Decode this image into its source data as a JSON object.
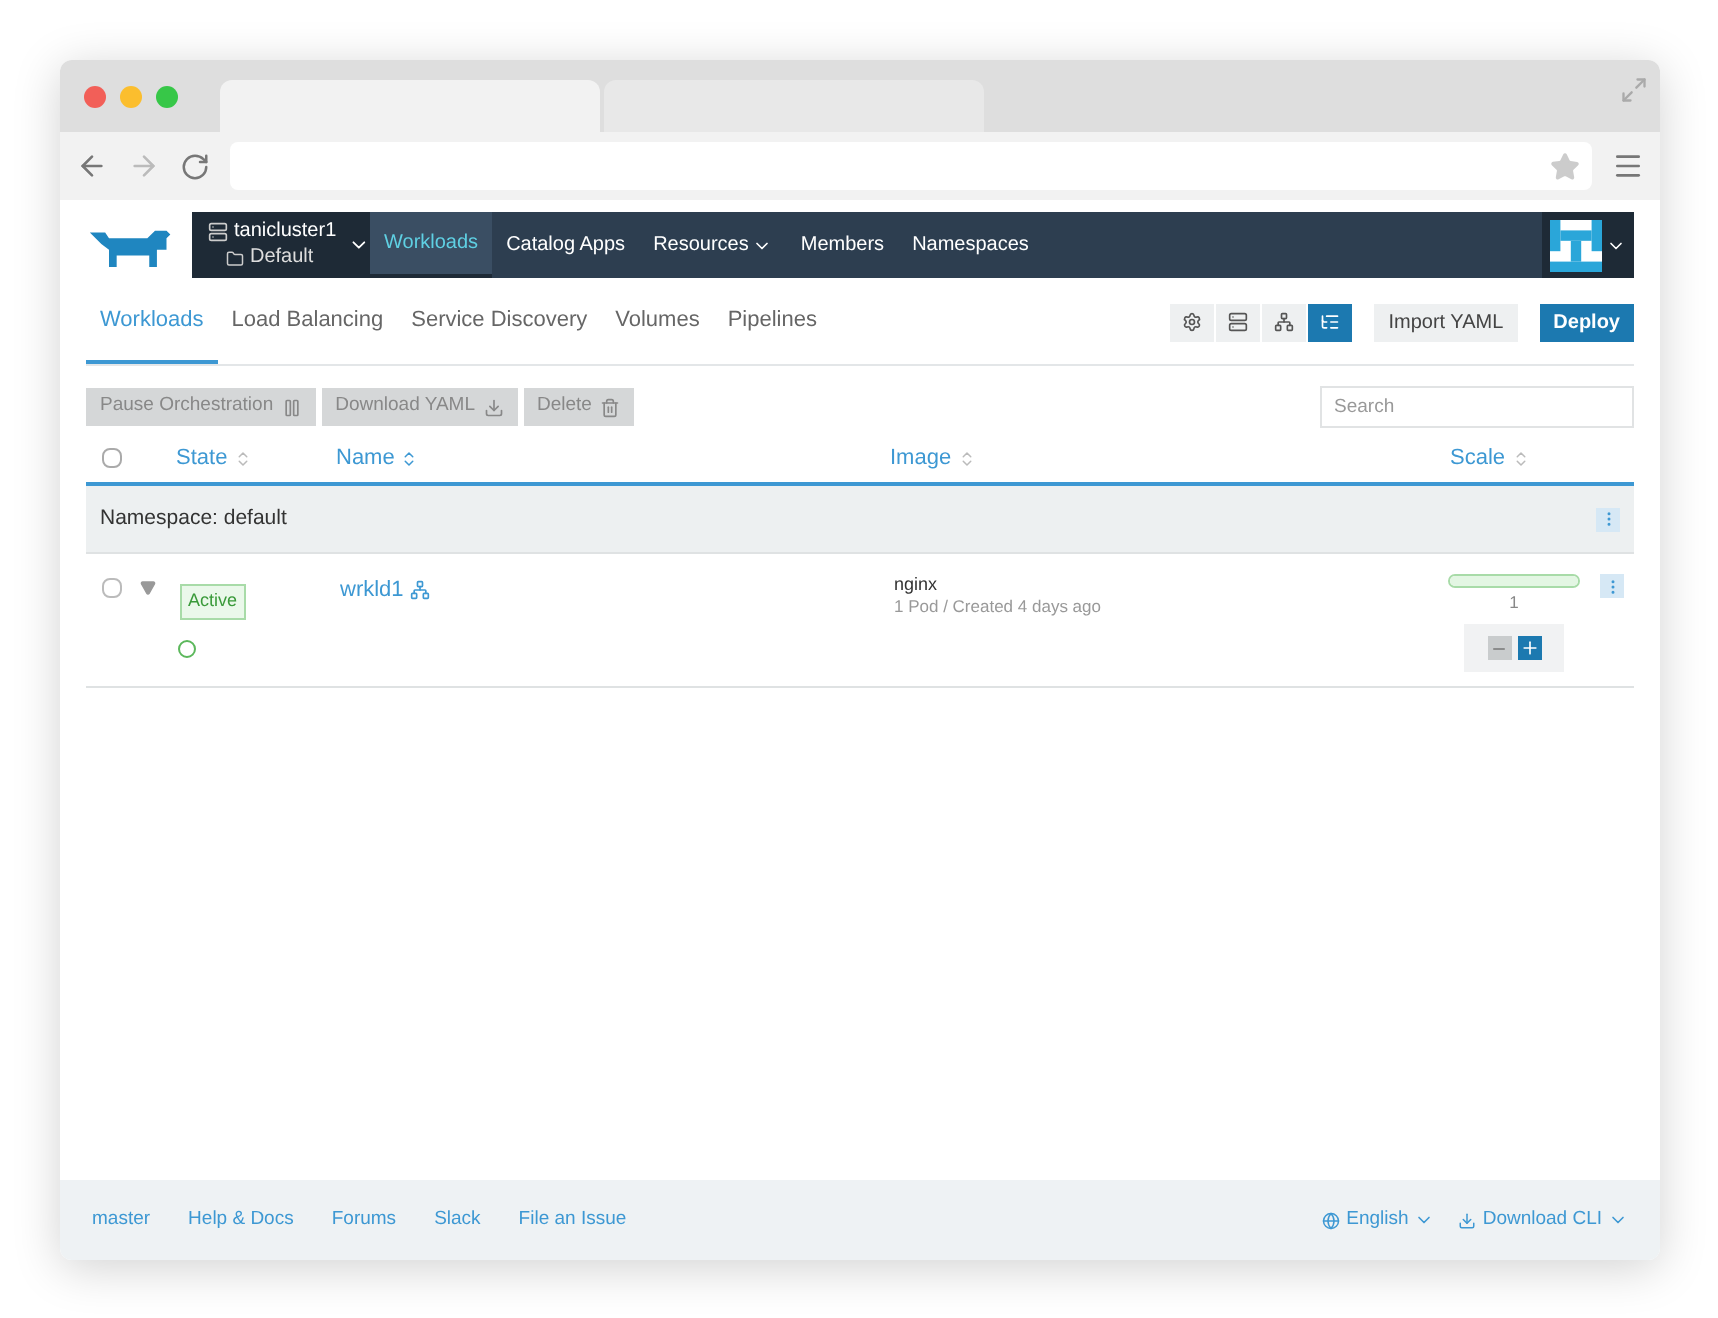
{
  "header": {
    "cluster": "tanicluster1",
    "project": "Default",
    "nav": [
      {
        "label": "Workloads",
        "selected": true,
        "caret": false
      },
      {
        "label": "Catalog Apps",
        "selected": false,
        "caret": false
      },
      {
        "label": "Resources",
        "selected": false,
        "caret": true
      },
      {
        "label": "Members",
        "selected": false,
        "caret": false
      },
      {
        "label": "Namespaces",
        "selected": false,
        "caret": false
      }
    ]
  },
  "tabs": [
    {
      "label": "Workloads",
      "selected": true
    },
    {
      "label": "Load Balancing",
      "selected": false
    },
    {
      "label": "Service Discovery",
      "selected": false
    },
    {
      "label": "Volumes",
      "selected": false
    },
    {
      "label": "Pipelines",
      "selected": false
    }
  ],
  "views": [
    {
      "kind": "gear",
      "selected": false
    },
    {
      "kind": "list",
      "selected": false
    },
    {
      "kind": "nodes",
      "selected": false
    },
    {
      "kind": "tree",
      "selected": true
    }
  ],
  "actions": [
    "Import YAML",
    "Deploy"
  ],
  "bulk": [
    {
      "label": "Pause Orchestration",
      "kind": "pause",
      "disabled": true
    },
    {
      "label": "Download YAML",
      "kind": "download",
      "disabled": true
    },
    {
      "label": "Delete",
      "kind": "trash",
      "disabled": true
    }
  ],
  "search": {
    "placeholder": "Search"
  },
  "table": {
    "all_checked": false,
    "columns": [
      "State",
      "Name",
      "Image",
      "Scale"
    ],
    "groups": [
      {
        "title": "Namespace: default",
        "rows": [
          {
            "checked": false,
            "state": "Active",
            "name": "wrkld1",
            "image": "nginx",
            "detail": "1 Pod / Created 4 days ago",
            "scale": "1",
            "level": 1
          }
        ]
      }
    ]
  },
  "footer": {
    "links": [
      "master",
      "Help & Docs",
      "Forums",
      "Slack",
      "File an Issue"
    ],
    "language": "English",
    "cli": "Download CLI"
  }
}
